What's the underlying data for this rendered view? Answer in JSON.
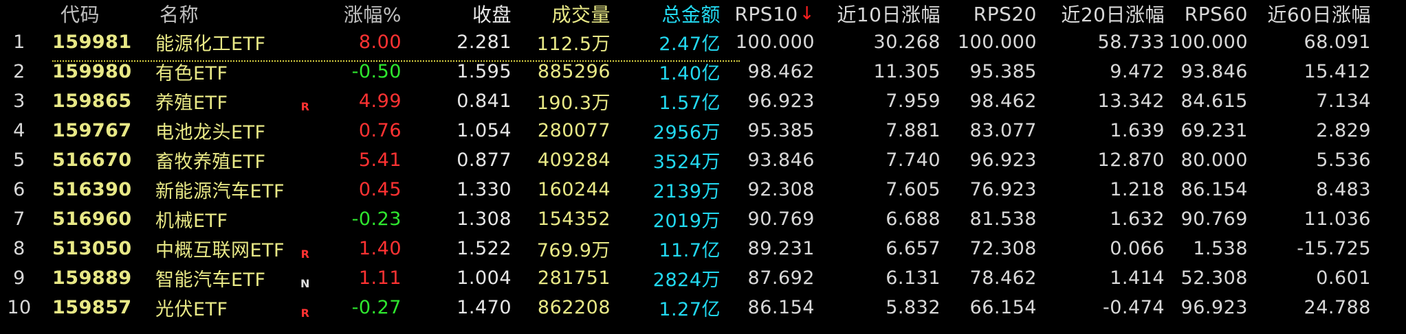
{
  "header": {
    "idx": "",
    "code": "代码",
    "name": "名称",
    "pct": "涨幅%",
    "close": "收盘",
    "vol": "成交量",
    "amt": "总金额",
    "rps10": "RPS10",
    "rps10_sort_icon": "down-arrow-icon",
    "chg10": "近10日涨幅",
    "rps20": "RPS20",
    "chg20": "近20日涨幅",
    "rps60": "RPS60",
    "chg60": "近60日涨幅"
  },
  "colors": {
    "background": "#000000",
    "up": "#ff3232",
    "down": "#2ee62e",
    "code_name_volume": "#e8e886",
    "amount": "#22d8f0",
    "sort_arrow": "#ff2020"
  },
  "rows": [
    {
      "idx": "1",
      "code": "159981",
      "name": "能源化工ETF",
      "flag": "",
      "pct": "8.00",
      "dir": "up",
      "close": "2.281",
      "vol": "112.5万",
      "amt": "2.47亿",
      "rps10": "100.000",
      "chg10": "30.268",
      "rps20": "100.000",
      "chg20": "58.733",
      "rps60": "100.000",
      "chg60": "68.091"
    },
    {
      "idx": "2",
      "code": "159980",
      "name": "有色ETF",
      "flag": "",
      "pct": "-0.50",
      "dir": "down",
      "close": "1.595",
      "vol": "885296",
      "amt": "1.40亿",
      "rps10": "98.462",
      "chg10": "11.305",
      "rps20": "95.385",
      "chg20": "9.472",
      "rps60": "93.846",
      "chg60": "15.412"
    },
    {
      "idx": "3",
      "code": "159865",
      "name": "养殖ETF",
      "flag": "R",
      "pct": "4.99",
      "dir": "up",
      "close": "0.841",
      "vol": "190.3万",
      "amt": "1.57亿",
      "rps10": "96.923",
      "chg10": "7.959",
      "rps20": "98.462",
      "chg20": "13.342",
      "rps60": "84.615",
      "chg60": "7.134"
    },
    {
      "idx": "4",
      "code": "159767",
      "name": "电池龙头ETF",
      "flag": "",
      "pct": "0.76",
      "dir": "up",
      "close": "1.054",
      "vol": "280077",
      "amt": "2956万",
      "rps10": "95.385",
      "chg10": "7.881",
      "rps20": "83.077",
      "chg20": "1.639",
      "rps60": "69.231",
      "chg60": "2.829"
    },
    {
      "idx": "5",
      "code": "516670",
      "name": "畜牧养殖ETF",
      "flag": "",
      "pct": "5.41",
      "dir": "up",
      "close": "0.877",
      "vol": "409284",
      "amt": "3524万",
      "rps10": "93.846",
      "chg10": "7.740",
      "rps20": "96.923",
      "chg20": "12.870",
      "rps60": "80.000",
      "chg60": "5.536"
    },
    {
      "idx": "6",
      "code": "516390",
      "name": "新能源汽车ETF",
      "flag": "",
      "pct": "0.45",
      "dir": "up",
      "close": "1.330",
      "vol": "160244",
      "amt": "2139万",
      "rps10": "92.308",
      "chg10": "7.605",
      "rps20": "76.923",
      "chg20": "1.218",
      "rps60": "86.154",
      "chg60": "8.483"
    },
    {
      "idx": "7",
      "code": "516960",
      "name": "机械ETF",
      "flag": "",
      "pct": "-0.23",
      "dir": "down",
      "close": "1.308",
      "vol": "154352",
      "amt": "2019万",
      "rps10": "90.769",
      "chg10": "6.688",
      "rps20": "81.538",
      "chg20": "1.632",
      "rps60": "90.769",
      "chg60": "11.036"
    },
    {
      "idx": "8",
      "code": "513050",
      "name": "中概互联网ETF",
      "flag": "R",
      "pct": "1.40",
      "dir": "up",
      "close": "1.522",
      "vol": "769.9万",
      "amt": "11.7亿",
      "rps10": "89.231",
      "chg10": "6.657",
      "rps20": "72.308",
      "chg20": "0.066",
      "rps60": "1.538",
      "chg60": "-15.725"
    },
    {
      "idx": "9",
      "code": "159889",
      "name": "智能汽车ETF",
      "flag": "N",
      "pct": "1.11",
      "dir": "up",
      "close": "1.004",
      "vol": "281751",
      "amt": "2824万",
      "rps10": "87.692",
      "chg10": "6.131",
      "rps20": "78.462",
      "chg20": "1.414",
      "rps60": "52.308",
      "chg60": "0.601"
    },
    {
      "idx": "10",
      "code": "159857",
      "name": "光伏ETF",
      "flag": "R",
      "pct": "-0.27",
      "dir": "down",
      "close": "1.470",
      "vol": "862208",
      "amt": "1.27亿",
      "rps10": "86.154",
      "chg10": "5.832",
      "rps20": "66.154",
      "chg20": "-0.474",
      "rps60": "96.923",
      "chg60": "24.788"
    }
  ]
}
